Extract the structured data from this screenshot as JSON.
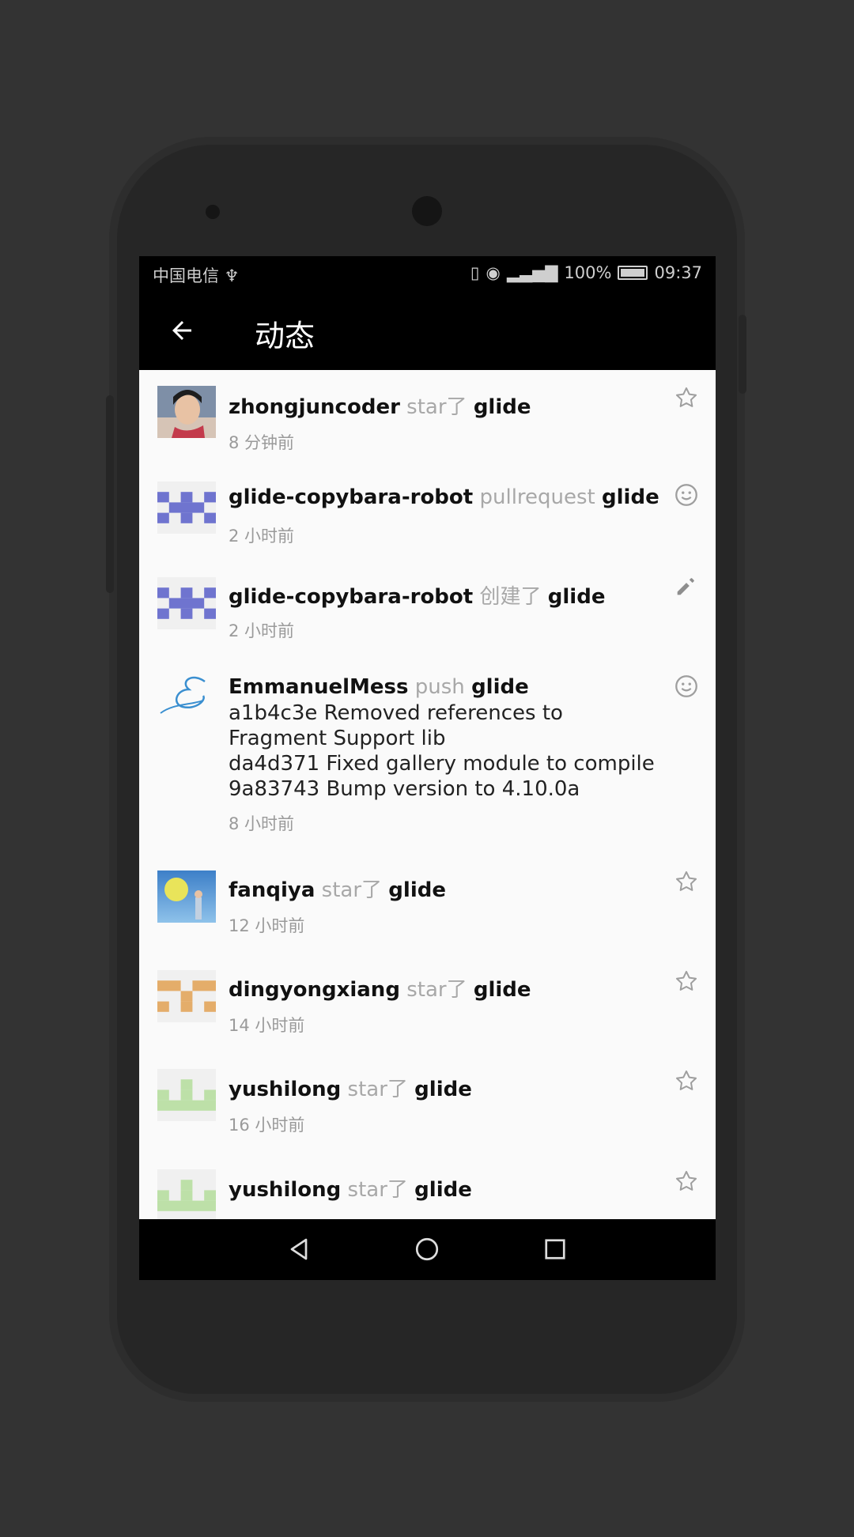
{
  "status_bar": {
    "carrier": "中国电信",
    "battery": "100%",
    "time": "09:37"
  },
  "app_bar": {
    "title": "动态"
  },
  "feed": [
    {
      "actor": "zhongjuncoder",
      "verb": "star了",
      "repo": "glide",
      "time": "8 分钟前",
      "icon": "star-outline-icon",
      "avatar": "photo-avatar"
    },
    {
      "actor": "glide-copybara-robot",
      "verb": "pullrequest ",
      "repo": "glide",
      "time": "2 小时前",
      "icon": "smiley-icon",
      "avatar": "identicon-blue"
    },
    {
      "actor": "glide-copybara-robot",
      "verb": "创建了",
      "repo": "glide",
      "time": "2 小时前",
      "icon": "pencil-icon",
      "avatar": "identicon-blue"
    },
    {
      "actor": "EmmanuelMess",
      "verb": "push ",
      "repo": "glide",
      "commits": [
        "a1b4c3e Removed references to",
        "Fragment Support lib",
        "da4d371 Fixed gallery module to compile",
        "9a83743 Bump version to 4.10.0a"
      ],
      "time": "8 小时前",
      "icon": "smiley-icon",
      "avatar": "script-e-avatar"
    },
    {
      "actor": "fanqiya",
      "verb": "star了",
      "repo": "glide",
      "time": "12 小时前",
      "icon": "star-outline-icon",
      "avatar": "photo-avatar"
    },
    {
      "actor": "dingyongxiang",
      "verb": "star了",
      "repo": "glide",
      "time": "14 小时前",
      "icon": "star-outline-icon",
      "avatar": "identicon-orange"
    },
    {
      "actor": "yushilong",
      "verb": "star了",
      "repo": "glide",
      "time": "16 小时前",
      "icon": "star-outline-icon",
      "avatar": "identicon-green"
    },
    {
      "actor": "yushilong",
      "verb": "star了",
      "repo": "glide",
      "time": "",
      "icon": "star-outline-icon",
      "avatar": "identicon-green"
    }
  ],
  "colors": {
    "identicon_blue": "#6f74cf",
    "identicon_orange": "#e4ad6a",
    "identicon_green": "#bde0a8",
    "background": "#fafafa",
    "verb_gray": "#a8a8a8"
  }
}
